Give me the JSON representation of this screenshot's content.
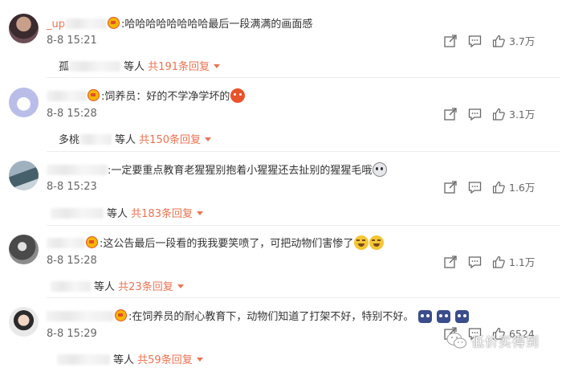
{
  "comments": [
    {
      "name_prefix": "_up",
      "text": ":哈哈哈哈哈哈哈哈最后一段满满的画面感",
      "time": "8-8 15:21",
      "likes": "3.7万",
      "reply_prefix": "孤",
      "reply_suffix": "等人",
      "reply_more": "共191条回复"
    },
    {
      "name_prefix": "",
      "text": ":饲养员：好的不学净学坏的",
      "time": "8-8 15:28",
      "likes": "3.1万",
      "reply_prefix": "多桃",
      "reply_suffix": "等人",
      "reply_more": "共150条回复"
    },
    {
      "name_prefix": "",
      "text": ":一定要重点教育老猩猩别抱着小猩猩还去扯别的猩猩毛哦",
      "time": "8-8 15:23",
      "likes": "1.6万",
      "reply_prefix": "",
      "reply_suffix": "等人",
      "reply_more": "共183条回复"
    },
    {
      "name_prefix": "",
      "text": ":这公告最后一段看的我我要笑喷了，可把动物们害惨了",
      "time": "8-8 15:28",
      "likes": "1.1万",
      "reply_prefix": "",
      "reply_suffix": "等人",
      "reply_more": "共23条回复"
    },
    {
      "name_prefix": "",
      "text": ":在饲养员的耐心教育下，动物们知道了打架不好，特别不好。",
      "time": "8-8 15:29",
      "likes": "6524",
      "reply_prefix": "",
      "reply_suffix": "等人",
      "reply_more": "共59条回复"
    }
  ],
  "watermark": "低价买得到",
  "icons": {
    "share": "share-icon",
    "comment": "comment-icon",
    "like": "thumbs-up-icon"
  },
  "colors": {
    "accent": "#eb7350",
    "text": "#333333",
    "muted": "#666666"
  }
}
